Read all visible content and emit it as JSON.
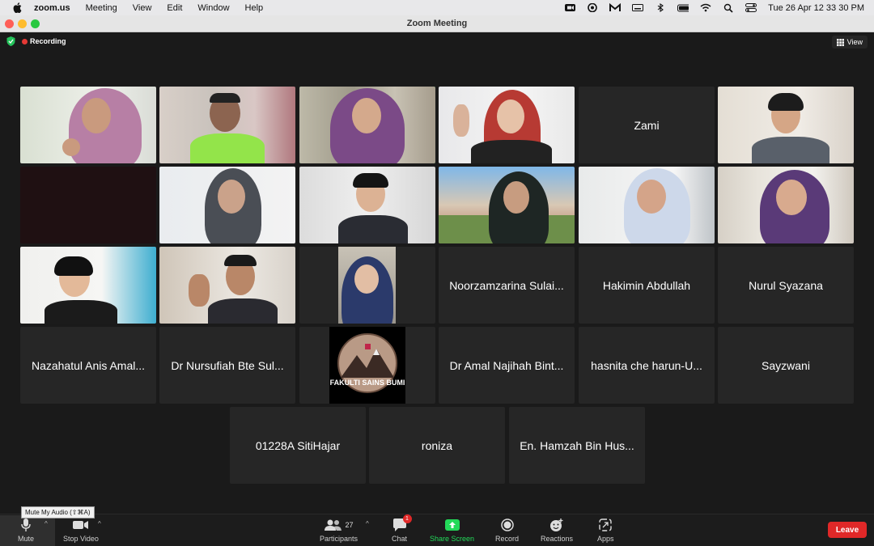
{
  "menubar": {
    "app": "zoom.us",
    "items": [
      "Meeting",
      "View",
      "Edit",
      "Window",
      "Help"
    ],
    "clock": "Tue 26 Apr  12 33 30 PM"
  },
  "window": {
    "title": "Zoom Meeting"
  },
  "status": {
    "recording": "Recording",
    "view": "View"
  },
  "tiles": {
    "t5": "Zami",
    "t16": "Noorzamzarina Sulai...",
    "t17": "Hakimin Abdullah",
    "t18": "Nurul Syazana",
    "t19": "Nazahatul Anis Amal...",
    "t20": "Dr Nursufiah Bte Sul...",
    "t22": "Dr Amal Najihah Bint...",
    "t23": "hasnita che harun-U...",
    "t24": "Sayzwani",
    "t25": "01228A SitiHajar",
    "t26": "roniza",
    "t27": "En. Hamzah Bin Hus..."
  },
  "logo_text": "FAKULTI SAINS BUMI",
  "toolbar": {
    "mute": "Mute",
    "mute_tooltip": "Mute My Audio (⇧⌘A)",
    "stop_video": "Stop Video",
    "participants": "Participants",
    "participant_count": "27",
    "chat": "Chat",
    "chat_badge": "1",
    "share": "Share Screen",
    "record": "Record",
    "reactions": "Reactions",
    "apps": "Apps",
    "leave": "Leave"
  },
  "colors": {
    "accent_green": "#23d959",
    "leave_red": "#e02828",
    "tile_bg": "#262626"
  }
}
